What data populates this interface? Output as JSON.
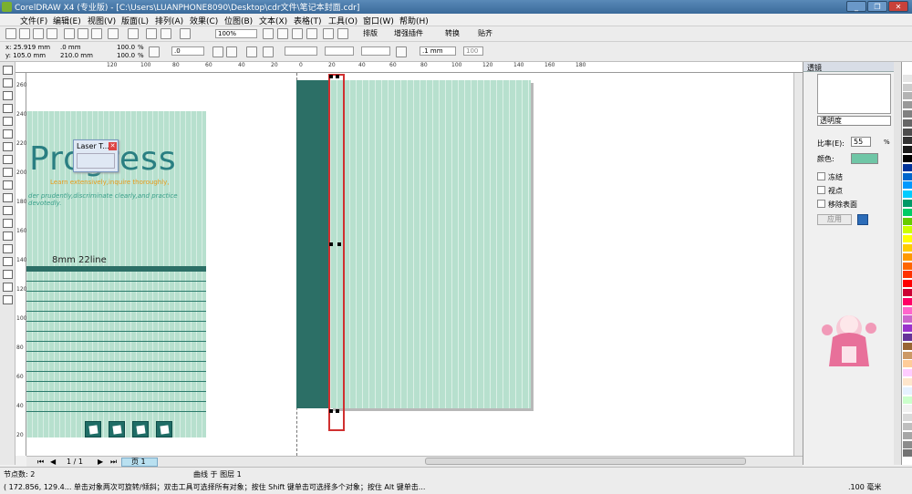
{
  "window": {
    "title": "CorelDRAW X4 (专业版) - [C:\\Users\\LUANPHONE8090\\Desktop\\cdr文件\\笔记本封面.cdr]",
    "controls": [
      "_",
      "❐",
      "✕"
    ]
  },
  "menu": [
    "文件(F)",
    "编辑(E)",
    "视图(V)",
    "版面(L)",
    "排列(A)",
    "效果(C)",
    "位图(B)",
    "文本(X)",
    "表格(T)",
    "工具(O)",
    "窗口(W)",
    "帮助(H)"
  ],
  "standard_bar": {
    "zoom": "100%",
    "snap": "贴齐",
    "buttons": [
      "排版",
      "增强插件",
      "转换",
      "贴齐"
    ]
  },
  "property_bar": {
    "x": "x: 25.919 mm",
    "y": "y: 105.0 mm",
    "w": ".0 mm",
    "h": "210.0 mm",
    "sx": "100.0",
    "sy": "100.0",
    "pct": "%",
    "angle": ".0",
    "outline": ".1 mm",
    "scale100": "100"
  },
  "laser_window": {
    "title": "Laser T...",
    "close": "✕"
  },
  "design": {
    "brand": "Progress",
    "tagline1": "Learn extensively,inquire thoroughly,",
    "tagline2": "der prudently,discriminate clearly,and practice devotedly.",
    "spec": "8mm    22line"
  },
  "ruler_h": [
    "120",
    "100",
    "80",
    "60",
    "40",
    "20",
    "0",
    "20",
    "40",
    "60",
    "80",
    "100",
    "120",
    "140",
    "160",
    "180"
  ],
  "ruler_v": [
    "260",
    "240",
    "220",
    "200",
    "180",
    "160",
    "140",
    "120",
    "100",
    "80",
    "60",
    "40",
    "20"
  ],
  "page_nav": {
    "count": "1 / 1",
    "tab": "页 1"
  },
  "docker": {
    "title": "透镜",
    "lens_type": "透明度",
    "rate_label": "比率(E):",
    "rate_value": "55",
    "pct": "%",
    "color_label": "颜色:",
    "options": [
      "冻结",
      "视点",
      "移除表面"
    ],
    "apply": "应用"
  },
  "status": {
    "nodes": "节点数: 2",
    "object": "曲线 于 图层 1",
    "hint": "( 172.856, 129.4... 单击对象两次可旋转/倾斜；双击工具可选择所有对象；按住 Shift 键单击可选择多个对象；按住 Alt 键单击...",
    "outline": ".100 毫米"
  },
  "colors": {
    "cover": "#b7e0ce",
    "spine": "#2c6f66",
    "brand_text": "#2a7f82",
    "accent": "#e89a18",
    "selection": "#d03030",
    "palette": [
      "#ffffff",
      "#e6e6e6",
      "#cccccc",
      "#b3b3b3",
      "#999999",
      "#808080",
      "#666666",
      "#4d4d4d",
      "#333333",
      "#1a1a1a",
      "#000000",
      "#003399",
      "#0066cc",
      "#0099ff",
      "#00ccff",
      "#009966",
      "#00cc66",
      "#66cc00",
      "#ccff00",
      "#ffff00",
      "#ffcc00",
      "#ff9900",
      "#ff6600",
      "#ff3300",
      "#ff0000",
      "#cc0033",
      "#ff0066",
      "#ff66cc",
      "#cc66cc",
      "#9933cc",
      "#663399",
      "#996633",
      "#cc9966",
      "#ffcc99",
      "#ffccff",
      "#ffe6cc",
      "#e6f2ff",
      "#ccffcc",
      "#f2f2f2",
      "#d9d9d9",
      "#bfbfbf",
      "#a6a6a6",
      "#8c8c8c",
      "#737373"
    ]
  }
}
